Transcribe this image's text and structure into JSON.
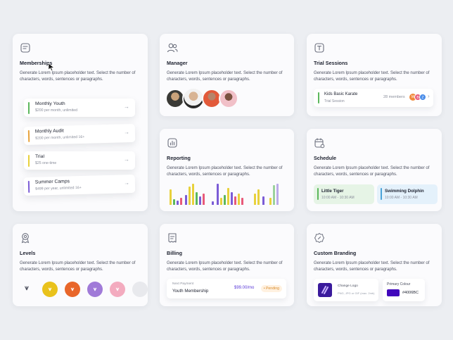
{
  "cards": {
    "memberships": {
      "title": "Memberships",
      "desc": "Generate Lorem Ipsum placeholder text. Select the number of characters, words, sentences or paragraphs.",
      "plans": [
        {
          "name": "Monthly Youth",
          "price": "$200 per month, unlimited",
          "color": "#5cb85c"
        },
        {
          "name": "Monthly Audit",
          "price": "$200 per month, unlimited 16+",
          "color": "#e8a33c"
        },
        {
          "name": "Trial",
          "price": "$25 one-time",
          "color": "#e8d13c"
        },
        {
          "name": "Summer Camps",
          "price": "$499 per year, unlimited 16+",
          "color": "#7b5cd6"
        }
      ]
    },
    "manager": {
      "title": "Manager",
      "desc": "Generate Lorem Ipsum placeholder text. Select the number of characters, words, sentences or paragraphs."
    },
    "trial": {
      "title": "Trial Sessions",
      "desc": "Generate Lorem Ipsum placeholder text. Select the number of characters, words, sentences or paragraphs.",
      "session_name": "Kids Basic Karate",
      "session_sub": "Trial Session",
      "members": "28 members",
      "member_initials": [
        "M",
        "B",
        "Z"
      ],
      "member_colors": [
        "#f08a3c",
        "#e85a7a",
        "#4a8ce8"
      ]
    },
    "reporting": {
      "title": "Reporting",
      "desc": "Generate Lorem Ipsum placeholder text. Select the number of characters, words, sentences or paragraphs."
    },
    "schedule": {
      "title": "Schedule",
      "desc": "Generate Lorem Ipsum placeholder text. Select the number of characters, words, sentences or paragraphs.",
      "slots": [
        {
          "title": "Little Tiger",
          "time": "10:00 AM - 10:30 AM",
          "bg": "#e6f4e6",
          "color": "#5cb85c"
        },
        {
          "title": "Swimming Dolphin",
          "time": "10:00 AM - 10:30 AM",
          "bg": "#e4f1fb",
          "color": "#4aa3d8"
        }
      ]
    },
    "levels": {
      "title": "Levels",
      "desc": "Generate Lorem Ipsum placeholder text. Select the number of characters, words, sentences or paragraphs.",
      "colors": [
        "#e9c21c",
        "#e8662a",
        "#a07ad8",
        "#f08aa6"
      ]
    },
    "billing": {
      "title": "Billing",
      "desc": "Generate Lorem Ipsum placeholder text. Select the number of characters, words, sentences or paragraphs.",
      "next_label": "Next Payment",
      "next_item": "Youth Membership",
      "amount": "$99.00/mo",
      "status": "• Pending"
    },
    "branding": {
      "title": "Custom Branding",
      "desc": "Generate Lorem Ipsum placeholder text. Select the number of characters, words, sentences or paragraphs.",
      "logo_label": "Change Logo",
      "logo_hint": "PNG, JPG or GIF (max. 2mb)",
      "primary_label": "Primary Colour",
      "primary_hex": "#4006BC"
    }
  }
}
